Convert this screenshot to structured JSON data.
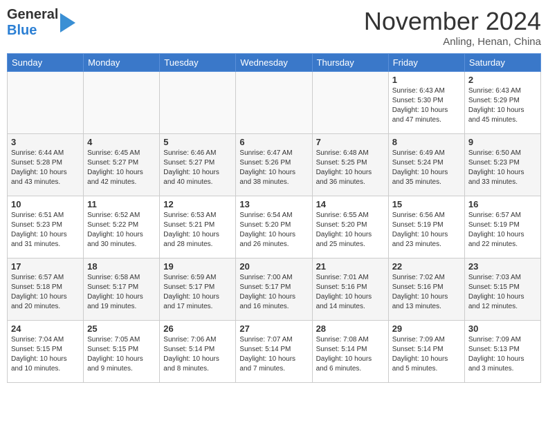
{
  "header": {
    "logo_line1": "General",
    "logo_line2": "Blue",
    "month": "November 2024",
    "location": "Anling, Henan, China"
  },
  "weekdays": [
    "Sunday",
    "Monday",
    "Tuesday",
    "Wednesday",
    "Thursday",
    "Friday",
    "Saturday"
  ],
  "weeks": [
    [
      {
        "day": "",
        "info": ""
      },
      {
        "day": "",
        "info": ""
      },
      {
        "day": "",
        "info": ""
      },
      {
        "day": "",
        "info": ""
      },
      {
        "day": "",
        "info": ""
      },
      {
        "day": "1",
        "info": "Sunrise: 6:43 AM\nSunset: 5:30 PM\nDaylight: 10 hours and 47 minutes."
      },
      {
        "day": "2",
        "info": "Sunrise: 6:43 AM\nSunset: 5:29 PM\nDaylight: 10 hours and 45 minutes."
      }
    ],
    [
      {
        "day": "3",
        "info": "Sunrise: 6:44 AM\nSunset: 5:28 PM\nDaylight: 10 hours and 43 minutes."
      },
      {
        "day": "4",
        "info": "Sunrise: 6:45 AM\nSunset: 5:27 PM\nDaylight: 10 hours and 42 minutes."
      },
      {
        "day": "5",
        "info": "Sunrise: 6:46 AM\nSunset: 5:27 PM\nDaylight: 10 hours and 40 minutes."
      },
      {
        "day": "6",
        "info": "Sunrise: 6:47 AM\nSunset: 5:26 PM\nDaylight: 10 hours and 38 minutes."
      },
      {
        "day": "7",
        "info": "Sunrise: 6:48 AM\nSunset: 5:25 PM\nDaylight: 10 hours and 36 minutes."
      },
      {
        "day": "8",
        "info": "Sunrise: 6:49 AM\nSunset: 5:24 PM\nDaylight: 10 hours and 35 minutes."
      },
      {
        "day": "9",
        "info": "Sunrise: 6:50 AM\nSunset: 5:23 PM\nDaylight: 10 hours and 33 minutes."
      }
    ],
    [
      {
        "day": "10",
        "info": "Sunrise: 6:51 AM\nSunset: 5:23 PM\nDaylight: 10 hours and 31 minutes."
      },
      {
        "day": "11",
        "info": "Sunrise: 6:52 AM\nSunset: 5:22 PM\nDaylight: 10 hours and 30 minutes."
      },
      {
        "day": "12",
        "info": "Sunrise: 6:53 AM\nSunset: 5:21 PM\nDaylight: 10 hours and 28 minutes."
      },
      {
        "day": "13",
        "info": "Sunrise: 6:54 AM\nSunset: 5:20 PM\nDaylight: 10 hours and 26 minutes."
      },
      {
        "day": "14",
        "info": "Sunrise: 6:55 AM\nSunset: 5:20 PM\nDaylight: 10 hours and 25 minutes."
      },
      {
        "day": "15",
        "info": "Sunrise: 6:56 AM\nSunset: 5:19 PM\nDaylight: 10 hours and 23 minutes."
      },
      {
        "day": "16",
        "info": "Sunrise: 6:57 AM\nSunset: 5:19 PM\nDaylight: 10 hours and 22 minutes."
      }
    ],
    [
      {
        "day": "17",
        "info": "Sunrise: 6:57 AM\nSunset: 5:18 PM\nDaylight: 10 hours and 20 minutes."
      },
      {
        "day": "18",
        "info": "Sunrise: 6:58 AM\nSunset: 5:17 PM\nDaylight: 10 hours and 19 minutes."
      },
      {
        "day": "19",
        "info": "Sunrise: 6:59 AM\nSunset: 5:17 PM\nDaylight: 10 hours and 17 minutes."
      },
      {
        "day": "20",
        "info": "Sunrise: 7:00 AM\nSunset: 5:17 PM\nDaylight: 10 hours and 16 minutes."
      },
      {
        "day": "21",
        "info": "Sunrise: 7:01 AM\nSunset: 5:16 PM\nDaylight: 10 hours and 14 minutes."
      },
      {
        "day": "22",
        "info": "Sunrise: 7:02 AM\nSunset: 5:16 PM\nDaylight: 10 hours and 13 minutes."
      },
      {
        "day": "23",
        "info": "Sunrise: 7:03 AM\nSunset: 5:15 PM\nDaylight: 10 hours and 12 minutes."
      }
    ],
    [
      {
        "day": "24",
        "info": "Sunrise: 7:04 AM\nSunset: 5:15 PM\nDaylight: 10 hours and 10 minutes."
      },
      {
        "day": "25",
        "info": "Sunrise: 7:05 AM\nSunset: 5:15 PM\nDaylight: 10 hours and 9 minutes."
      },
      {
        "day": "26",
        "info": "Sunrise: 7:06 AM\nSunset: 5:14 PM\nDaylight: 10 hours and 8 minutes."
      },
      {
        "day": "27",
        "info": "Sunrise: 7:07 AM\nSunset: 5:14 PM\nDaylight: 10 hours and 7 minutes."
      },
      {
        "day": "28",
        "info": "Sunrise: 7:08 AM\nSunset: 5:14 PM\nDaylight: 10 hours and 6 minutes."
      },
      {
        "day": "29",
        "info": "Sunrise: 7:09 AM\nSunset: 5:14 PM\nDaylight: 10 hours and 5 minutes."
      },
      {
        "day": "30",
        "info": "Sunrise: 7:09 AM\nSunset: 5:13 PM\nDaylight: 10 hours and 3 minutes."
      }
    ]
  ]
}
